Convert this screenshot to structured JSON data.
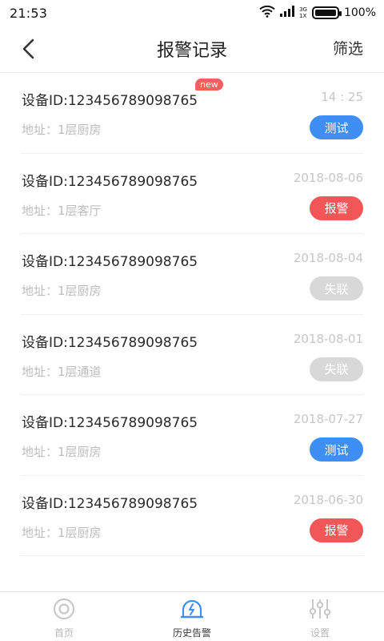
{
  "status_bar": {
    "time": "21:53",
    "network": "3G",
    "network_sub": "1X",
    "battery": "100%"
  },
  "header": {
    "title": "报警记录",
    "filter_label": "筛选"
  },
  "alarms": [
    {
      "device": "设备ID:123456789098765",
      "time": "14 : 25",
      "address": "地址：1层厨房",
      "status": "测试",
      "is_new": true,
      "new_label": "new"
    },
    {
      "device": "设备ID:123456789098765",
      "time": "2018-08-06",
      "address": "地址：1层客厅",
      "status": "报警"
    },
    {
      "device": "设备ID:123456789098765",
      "time": "2018-08-04",
      "address": "地址：1层厨房",
      "status": "失联"
    },
    {
      "device": "设备ID:123456789098765",
      "time": "2018-08-01",
      "address": "地址：1层通道",
      "status": "失联"
    },
    {
      "device": "设备ID:123456789098765",
      "time": "2018-07-27",
      "address": "地址：1层厨房",
      "status": "测试"
    },
    {
      "device": "设备ID:123456789098765",
      "time": "2018-06-30",
      "address": "地址：1层厨房",
      "status": "报警"
    }
  ],
  "tabs": [
    {
      "label": "首页",
      "icon": "home-icon",
      "active": false
    },
    {
      "label": "历史告警",
      "icon": "alarm-history-icon",
      "active": true
    },
    {
      "label": "设置",
      "icon": "settings-sliders-icon",
      "active": false
    }
  ],
  "colors": {
    "test": "#3f8ef4",
    "alarm": "#f25757",
    "lost": "#d8d8d8",
    "new_badge": "#f26060",
    "active_tab_icon": "#3f8ef4"
  }
}
